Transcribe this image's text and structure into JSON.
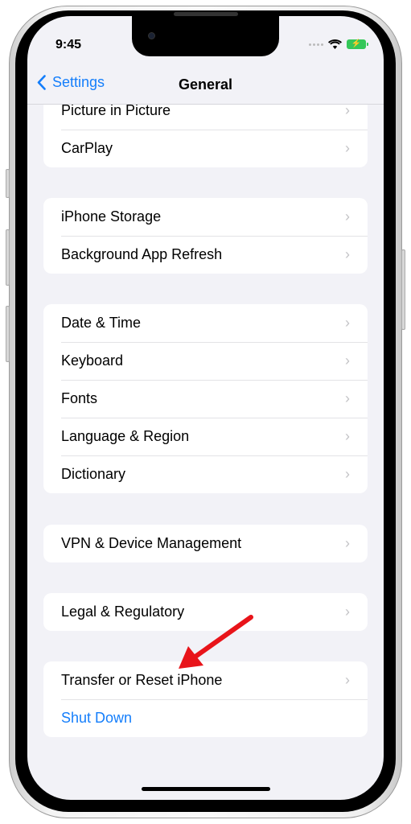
{
  "status": {
    "time": "9:45",
    "icons": [
      "signal-dots-icon",
      "wifi-icon",
      "battery-charging-icon"
    ]
  },
  "nav": {
    "back_label": "Settings",
    "title": "General"
  },
  "groups": [
    {
      "items": [
        {
          "label": "Picture in Picture"
        },
        {
          "label": "CarPlay"
        }
      ]
    },
    {
      "items": [
        {
          "label": "iPhone Storage"
        },
        {
          "label": "Background App Refresh"
        }
      ]
    },
    {
      "items": [
        {
          "label": "Date & Time"
        },
        {
          "label": "Keyboard"
        },
        {
          "label": "Fonts"
        },
        {
          "label": "Language & Region"
        },
        {
          "label": "Dictionary"
        }
      ]
    },
    {
      "items": [
        {
          "label": "VPN & Device Management"
        }
      ]
    },
    {
      "items": [
        {
          "label": "Legal & Regulatory"
        }
      ]
    },
    {
      "items": [
        {
          "label": "Transfer or Reset iPhone"
        },
        {
          "label": "Shut Down",
          "style": "action"
        }
      ]
    }
  ],
  "chevron": "›",
  "annotation": {
    "type": "red-arrow",
    "points_to": "Transfer or Reset iPhone",
    "color": "#e8141a"
  },
  "colors": {
    "accent": "#147efb",
    "background": "#f2f2f7"
  }
}
